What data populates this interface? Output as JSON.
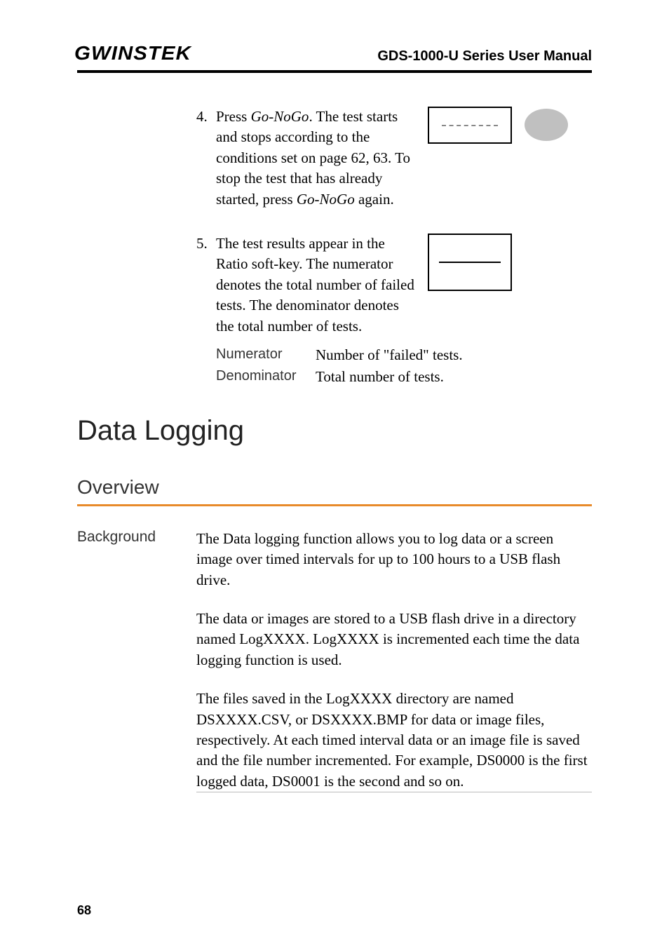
{
  "header": {
    "logo": "GWINSTEK",
    "title": "GDS-1000-U Series User Manual"
  },
  "steps": {
    "s4": {
      "num": "4.",
      "t1": "Press ",
      "go_nogoA": "Go-NoGo",
      "t2": ". The test starts and stops according to the conditions set on page 62, 63. To stop the test that has already started, press ",
      "go_nogoB": "Go-NoGo",
      "t3": " again."
    },
    "s5": {
      "num": "5.",
      "text": "The test results appear in the Ratio soft-key. The numerator denotes the total number of failed tests. The denominator denotes the total number of tests."
    },
    "sub": {
      "numerator_label": "Numerator",
      "numerator_val": "Number of \"failed\" tests.",
      "denominator_label": "Denominator",
      "denominator_val": "Total number of tests."
    }
  },
  "section": "Data Logging",
  "subsection": "Overview",
  "background": {
    "label": "Background",
    "p1": "The Data logging function allows you to log data or a screen image over timed intervals for up to 100 hours to a USB flash drive.",
    "p2": "The data or images are stored to a USB flash drive in a directory named LogXXXX. LogXXXX is incremented each time the data logging function is used.",
    "p3": "The files saved in the LogXXXX directory are named DSXXXX.CSV, or DSXXXX.BMP for data or image files, respectively. At each timed interval data or an image file is saved and the file number incremented. For example, DS0000 is the first logged data, DS0001 is the second and so on."
  },
  "page_number": "68"
}
